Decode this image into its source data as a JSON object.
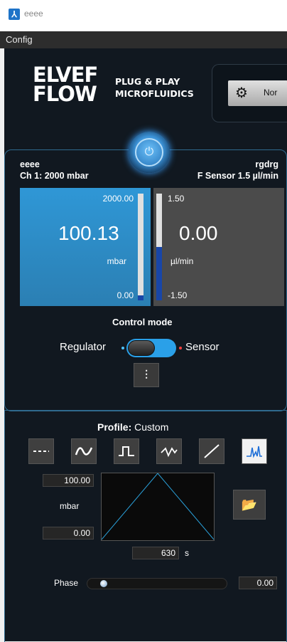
{
  "window": {
    "title": "eeee",
    "app_icon": "elveflow-icon"
  },
  "menu": {
    "items": [
      "Config"
    ]
  },
  "logo": {
    "line1": "ELVEF",
    "line2": "FLOW",
    "tagline1": "PLUG & PLAY",
    "tagline2": "MICROFLUIDICS"
  },
  "settings": {
    "label": "Nor"
  },
  "channel": {
    "left_name": "eeee",
    "left_desc": "Ch 1: 2000 mbar",
    "right_name": "rgdrg",
    "right_desc": "F Sensor 1.5 µl/min"
  },
  "pressure": {
    "max": "2000.00",
    "value": "100.13",
    "unit": "mbar",
    "min": "0.00",
    "level": 0.05
  },
  "flow": {
    "max": "1.50",
    "value": "0.00",
    "unit": "µl/min",
    "min": "-1.50",
    "level": 0.5
  },
  "control_mode": {
    "label": "Control mode",
    "left": "Regulator",
    "right": "Sensor",
    "state": "Regulator"
  },
  "profile": {
    "label": "Profile:",
    "value": "Custom",
    "waveforms": [
      "constant",
      "sine",
      "square",
      "sawtooth",
      "ramp",
      "custom"
    ],
    "selected": "custom",
    "max": "100.00",
    "unit": "mbar",
    "min": "0.00",
    "duration": "630",
    "duration_unit": "s"
  },
  "phase": {
    "label": "Phase",
    "value": "0.00"
  },
  "colors": {
    "accent": "#2b8fd0",
    "background": "#111820",
    "tile_left": "#2f97d6",
    "tile_right": "#4b4b4b"
  }
}
